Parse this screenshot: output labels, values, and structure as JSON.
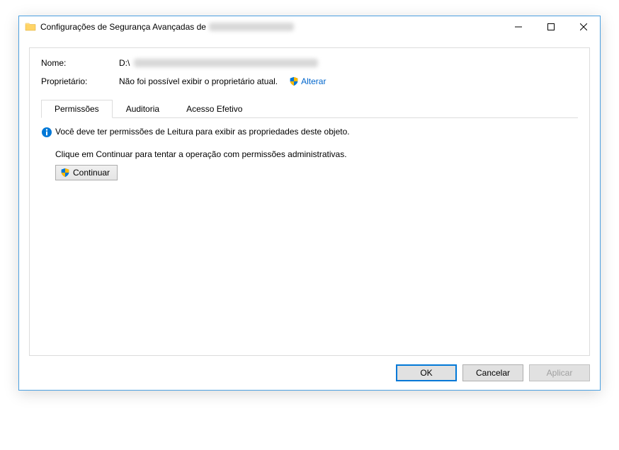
{
  "window": {
    "title_prefix": "Configurações de Segurança Avançadas de"
  },
  "fields": {
    "name_label": "Nome:",
    "name_value_prefix": "D:\\",
    "owner_label": "Proprietário:",
    "owner_text": "Não foi possível exibir o proprietário atual.",
    "change_link": "Alterar"
  },
  "tabs": {
    "permissions": "Permissões",
    "auditing": "Auditoria",
    "effective_access": "Acesso Efetivo"
  },
  "messages": {
    "info": "Você deve ter permissões de Leitura para exibir as propriedades deste objeto.",
    "instruction": "Clique em Continuar para tentar a operação com permissões administrativas.",
    "continue_btn": "Continuar"
  },
  "buttons": {
    "ok": "OK",
    "cancel": "Cancelar",
    "apply": "Aplicar"
  }
}
